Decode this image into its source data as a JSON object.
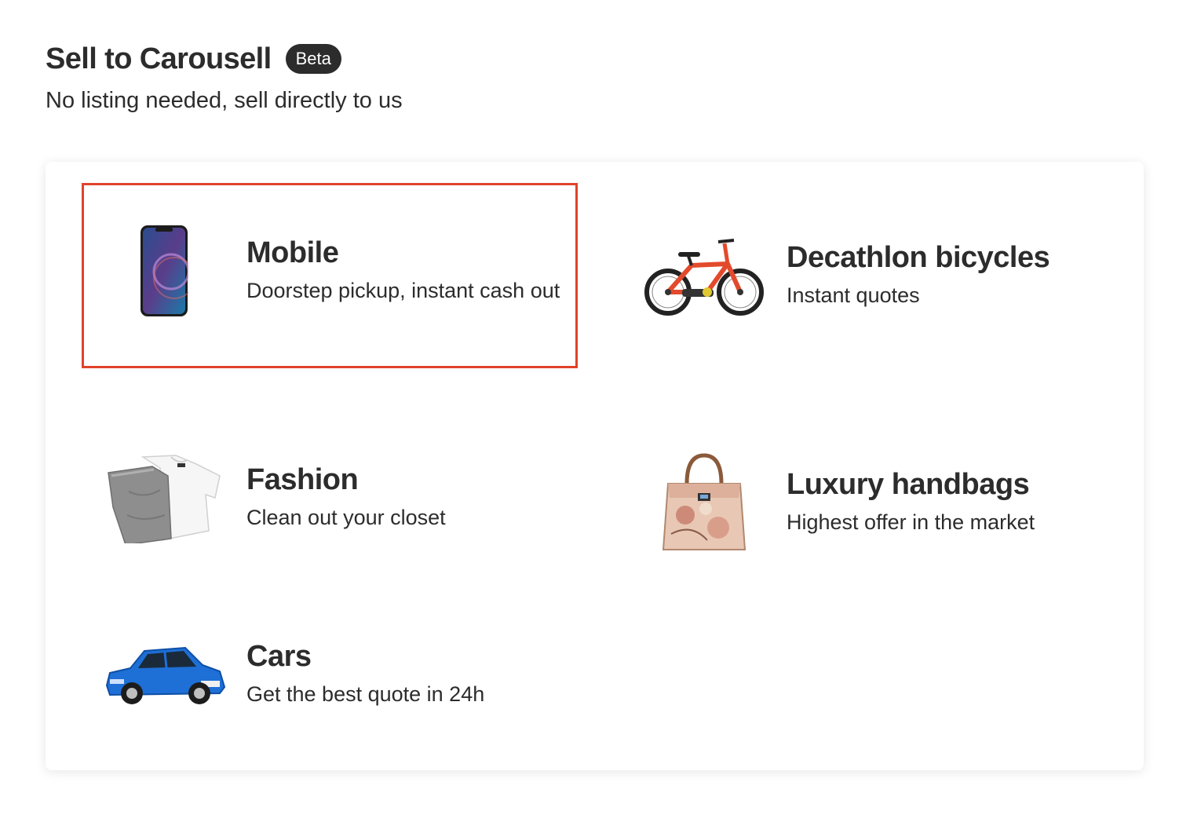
{
  "header": {
    "title": "Sell to Carousell",
    "badge": "Beta",
    "subtitle": "No listing needed, sell directly to us"
  },
  "categories": [
    {
      "title": "Mobile",
      "desc": "Doorstep pickup, instant cash out",
      "icon": "smartphone-icon",
      "highlighted": true
    },
    {
      "title": "Decathlon bicycles",
      "desc": "Instant quotes",
      "icon": "bicycle-icon"
    },
    {
      "title": "Fashion",
      "desc": "Clean out your closet",
      "icon": "clothes-icon"
    },
    {
      "title": "Luxury handbags",
      "desc": "Highest offer in the market",
      "icon": "handbag-icon"
    },
    {
      "title": "Cars",
      "desc": "Get the best quote in 24h",
      "icon": "car-icon"
    }
  ],
  "colors": {
    "highlight_border": "#e0432b",
    "text": "#2c2c2c",
    "badge_bg": "#2c2c2c"
  }
}
